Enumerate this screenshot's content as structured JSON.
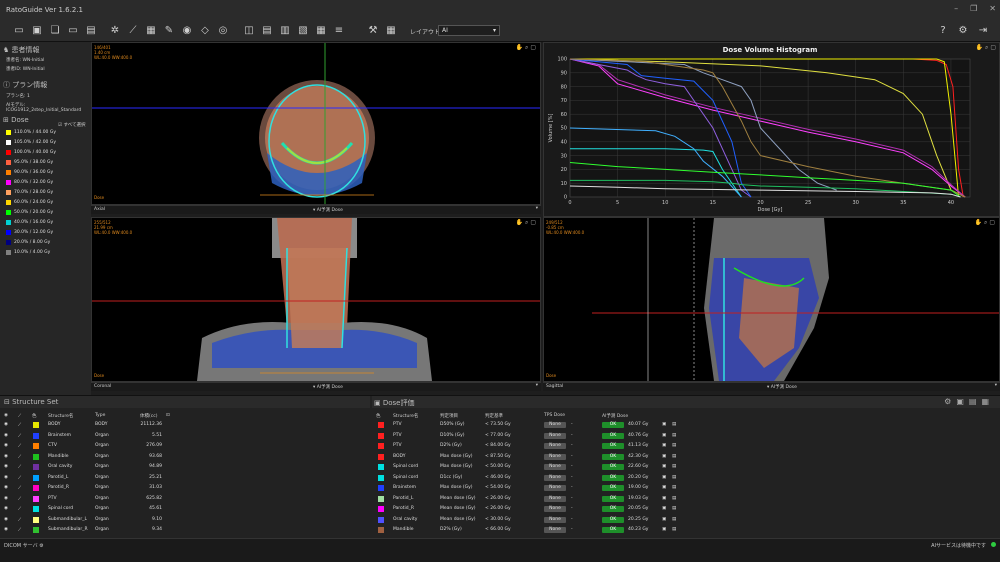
{
  "app": {
    "title": "RatoGuide Ver 1.6.2.1"
  },
  "toolbar": {
    "layout_label": "レイアウト選択",
    "layout_value": "AI"
  },
  "patient": {
    "header": "患者情報",
    "rows": [
      {
        "k": "患者名",
        "v": "WN-Initial"
      },
      {
        "k": "患者ID",
        "v": "WN-Initial"
      }
    ]
  },
  "plan": {
    "header": "プラン情報",
    "rows": [
      {
        "k": "プラン名",
        "v": "1"
      },
      {
        "k": "AIモデル",
        "v": "ICOG1912_2step_Initial_Standard"
      }
    ]
  },
  "dose": {
    "header": "Dose",
    "select_all": "すべて選択",
    "levels": [
      {
        "label": "110.0% / 44.00 Gy",
        "color": "#ffff00"
      },
      {
        "label": "105.0% / 42.00 Gy",
        "color": "#ffffff"
      },
      {
        "label": "100.0% / 40.00 Gy",
        "color": "#ff0000"
      },
      {
        "label": "95.0% / 38.00 Gy",
        "color": "#ff6040"
      },
      {
        "label": "90.0% / 36.00 Gy",
        "color": "#ff8000"
      },
      {
        "label": "80.0% / 32.00 Gy",
        "color": "#ff00ff"
      },
      {
        "label": "70.0% / 28.00 Gy",
        "color": "#ffa060"
      },
      {
        "label": "60.0% / 24.00 Gy",
        "color": "#ffd700"
      },
      {
        "label": "50.0% / 20.00 Gy",
        "color": "#00ff00"
      },
      {
        "label": "40.0% / 16.00 Gy",
        "color": "#00d0d0"
      },
      {
        "label": "30.0% / 12.00 Gy",
        "color": "#0000ff"
      },
      {
        "label": "20.0% / 8.00 Gy",
        "color": "#000080"
      },
      {
        "label": "10.0% / 4.00 Gy",
        "color": "#808080"
      }
    ]
  },
  "viewports": {
    "axial": {
      "info": [
        "146/401",
        "1.40 cm",
        "WL:40.0 WW:400.0"
      ],
      "name": "Axial",
      "mode": "AI予測 Dose",
      "dose": "Dose"
    },
    "coronal": {
      "info": [
        "255/512",
        "21.99 cm",
        "WL:40.0 WW:400.0"
      ],
      "name": "Coronal",
      "mode": "AI予測 Dose",
      "dose": "Dose"
    },
    "sagittal": {
      "info": [
        "249/512",
        "-0.85 cm",
        "WL:40.0 WW:400.0"
      ],
      "name": "Sagittal",
      "mode": "AI予測 Dose",
      "dose": "Dose"
    }
  },
  "chart_data": {
    "type": "line",
    "title": "Dose Volume Histogram",
    "xlabel": "Dose [Gy]",
    "ylabel": "Volume [%]",
    "xlim": [
      0,
      42
    ],
    "ylim": [
      0,
      100
    ],
    "xticks": [
      0,
      5,
      10,
      15,
      20,
      25,
      30,
      35,
      40
    ],
    "yticks": [
      0,
      10,
      20,
      30,
      40,
      50,
      60,
      70,
      80,
      90,
      100
    ],
    "grid": true,
    "series": [
      {
        "color": "#ff2020",
        "x": [
          0,
          36,
          38.5,
          39.5,
          40.2,
          40.8,
          41.3
        ],
        "y": [
          100,
          100,
          99,
          96,
          80,
          20,
          0
        ]
      },
      {
        "color": "#f0f000",
        "x": [
          0,
          38.5,
          39.3,
          40,
          40.8
        ],
        "y": [
          100,
          100,
          98,
          60,
          0
        ]
      },
      {
        "color": "#e0e040",
        "x": [
          0,
          10,
          20,
          27,
          32,
          35,
          37,
          38.5,
          40,
          41.5
        ],
        "y": [
          100,
          98,
          95,
          90,
          85,
          75,
          60,
          30,
          5,
          0
        ]
      },
      {
        "color": "#ff40ff",
        "x": [
          0,
          3,
          5,
          10,
          15,
          20,
          25,
          30,
          35,
          38,
          40,
          41.5
        ],
        "y": [
          100,
          95,
          82,
          72,
          63,
          55,
          47,
          40,
          32,
          20,
          8,
          0
        ]
      },
      {
        "color": "#b030b0",
        "x": [
          0,
          3,
          5,
          10,
          15,
          20,
          25,
          30,
          35,
          38,
          40,
          41.5
        ],
        "y": [
          100,
          96,
          85,
          74,
          65,
          57,
          49,
          42,
          34,
          22,
          9,
          0
        ]
      },
      {
        "color": "#9060e0",
        "x": [
          0,
          6,
          7,
          8,
          10,
          12,
          13,
          15,
          17,
          18,
          19
        ],
        "y": [
          100,
          92,
          88,
          85,
          82,
          80,
          70,
          50,
          20,
          5,
          0
        ]
      },
      {
        "color": "#2060ff",
        "x": [
          0,
          6,
          7.5,
          10,
          13,
          15,
          17,
          18,
          19
        ],
        "y": [
          100,
          96,
          88,
          86,
          84,
          70,
          40,
          10,
          0
        ]
      },
      {
        "color": "#8ea0c0",
        "x": [
          0,
          12,
          14,
          16,
          18,
          19,
          20,
          24,
          26,
          28
        ],
        "y": [
          100,
          96,
          90,
          85,
          80,
          70,
          50,
          20,
          10,
          5
        ]
      },
      {
        "color": "#a08040",
        "x": [
          0,
          5,
          8,
          10,
          14,
          15,
          16,
          18,
          19,
          20,
          25,
          30,
          35,
          40,
          41.5
        ],
        "y": [
          100,
          99,
          98,
          96,
          92,
          90,
          80,
          55,
          40,
          30,
          22,
          15,
          10,
          5,
          0
        ]
      },
      {
        "color": "#20e0e0",
        "x": [
          0,
          10,
          14,
          15,
          16,
          18
        ],
        "y": [
          35,
          35,
          34,
          33,
          20,
          0
        ]
      },
      {
        "color": "#40b0ff",
        "x": [
          0,
          9,
          11,
          13,
          14,
          16,
          18
        ],
        "y": [
          50,
          48,
          44,
          35,
          26,
          15,
          0
        ]
      },
      {
        "color": "#30ff30",
        "x": [
          0,
          5,
          10,
          15,
          20,
          25,
          30,
          35,
          40,
          41
        ],
        "y": [
          25,
          22,
          20,
          18,
          16,
          14,
          12,
          10,
          5,
          0
        ]
      },
      {
        "color": "#20c060",
        "x": [
          0,
          10,
          15,
          17,
          18,
          20,
          25,
          30,
          35,
          40,
          41
        ],
        "y": [
          12,
          12,
          11,
          10,
          9,
          8,
          7,
          6,
          4,
          2,
          0
        ]
      },
      {
        "color": "#e0e0e0",
        "x": [
          0,
          5,
          10,
          20,
          30,
          38,
          40,
          41
        ],
        "y": [
          8,
          7,
          6,
          5,
          4,
          3,
          2,
          0
        ]
      }
    ]
  },
  "structure_set": {
    "header": "Structure Set",
    "cols": [
      "色",
      "Structure名",
      "Type",
      "体積(cc)"
    ],
    "rows": [
      {
        "color": "#e6e600",
        "name": "BODY",
        "type": "BODY",
        "vol": "21112.36"
      },
      {
        "color": "#2040ff",
        "name": "Brainstem",
        "type": "Organ",
        "vol": "5.51"
      },
      {
        "color": "#ff8000",
        "name": "CTV",
        "type": "Organ",
        "vol": "276.09"
      },
      {
        "color": "#1ec01e",
        "name": "Mandible",
        "type": "Organ",
        "vol": "93.68"
      },
      {
        "color": "#7030a0",
        "name": "Oral cavity",
        "type": "Organ",
        "vol": "94.89"
      },
      {
        "color": "#00a0ff",
        "name": "Parotid_L",
        "type": "Organ",
        "vol": "25.21"
      },
      {
        "color": "#ff00c0",
        "name": "Parotid_R",
        "type": "Organ",
        "vol": "31.03"
      },
      {
        "color": "#ff40ff",
        "name": "PTV",
        "type": "Organ",
        "vol": "625.82"
      },
      {
        "color": "#00e0e0",
        "name": "Spinal cord",
        "type": "Organ",
        "vol": "45.61"
      },
      {
        "color": "#ffff80",
        "name": "Submandibular_L",
        "type": "Organ",
        "vol": "9.10"
      },
      {
        "color": "#30c030",
        "name": "Submandibular_R",
        "type": "Organ",
        "vol": "9.34"
      }
    ]
  },
  "dose_eval": {
    "header": "Dose評価",
    "cols": [
      "色",
      "Structure名",
      "判定項目",
      "判定基準",
      "TPS Dose",
      "AI予測 Dose"
    ],
    "rows": [
      {
        "color": "#ff2020",
        "name": "PTV",
        "item": "D50% (Gy)",
        "crit": "< 73.50 Gy",
        "tps": "None",
        "ai": "40.07 Gy"
      },
      {
        "color": "#ff2020",
        "name": "PTV",
        "item": "D10% (Gy)",
        "crit": "< 77.00 Gy",
        "tps": "None",
        "ai": "40.76 Gy"
      },
      {
        "color": "#ff2020",
        "name": "PTV",
        "item": "D2% (Gy)",
        "crit": "< 84.00 Gy",
        "tps": "None",
        "ai": "41.13 Gy"
      },
      {
        "color": "#ff2020",
        "name": "BODY",
        "item": "Max dose (Gy)",
        "crit": "< 87.50 Gy",
        "tps": "None",
        "ai": "42.30 Gy"
      },
      {
        "color": "#00e0e0",
        "name": "Spinal cord",
        "item": "Max dose (Gy)",
        "crit": "< 50.00 Gy",
        "tps": "None",
        "ai": "22.60 Gy"
      },
      {
        "color": "#00e0e0",
        "name": "Spinal cord",
        "item": "D1cc (Gy)",
        "crit": "< 46.00 Gy",
        "tps": "None",
        "ai": "20.20 Gy"
      },
      {
        "color": "#2040ff",
        "name": "Brainstem",
        "item": "Max dose (Gy)",
        "crit": "< 54.00 Gy",
        "tps": "None",
        "ai": "19.00 Gy"
      },
      {
        "color": "#a0e0a0",
        "name": "Parotid_L",
        "item": "Mean dose (Gy)",
        "crit": "< 26.00 Gy",
        "tps": "None",
        "ai": "19.03 Gy"
      },
      {
        "color": "#ff00ff",
        "name": "Parotid_R",
        "item": "Mean dose (Gy)",
        "crit": "< 26.00 Gy",
        "tps": "None",
        "ai": "20.05 Gy"
      },
      {
        "color": "#5050ff",
        "name": "Oral cavity",
        "item": "Mean dose (Gy)",
        "crit": "< 30.00 Gy",
        "tps": "None",
        "ai": "20.25 Gy"
      },
      {
        "color": "#a06040",
        "name": "Mandible",
        "item": "D2% (Gy)",
        "crit": "< 66.00 Gy",
        "tps": "None",
        "ai": "40.23 Gy"
      }
    ],
    "ok": "OK",
    "dash": "-"
  },
  "status": {
    "left": "DICOM サーバ",
    "right": "AIサービスは待機中です"
  }
}
